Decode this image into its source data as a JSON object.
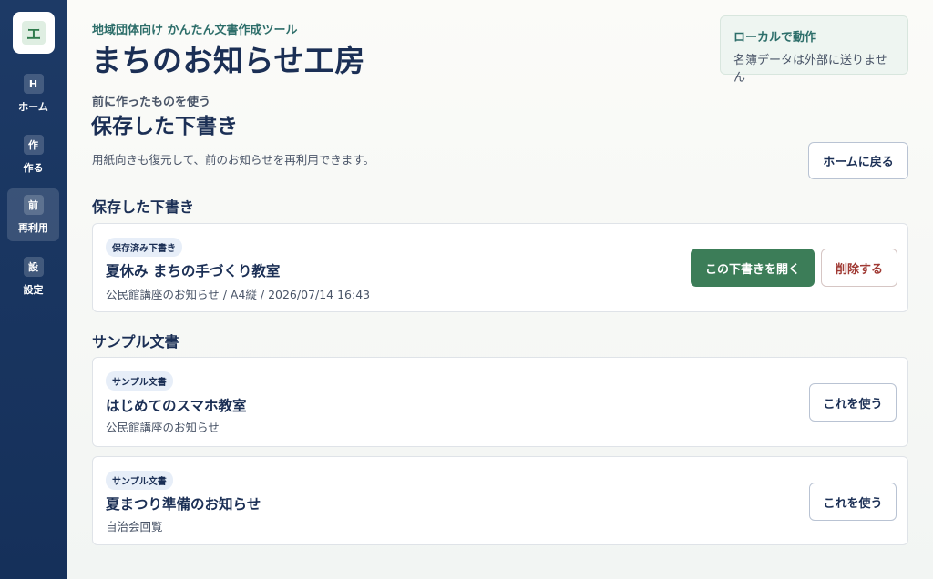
{
  "sidebar": {
    "logo_glyph": "エ",
    "items": [
      {
        "chip": "H",
        "label": "ホーム"
      },
      {
        "chip": "作",
        "label": "作る"
      },
      {
        "chip": "前",
        "label": "再利用"
      },
      {
        "chip": "設",
        "label": "設定"
      }
    ]
  },
  "header": {
    "eyebrow": "地域団体向け かんたん文書作成ツール",
    "title": "まちのお知らせ工房",
    "local_title": "ローカルで動作",
    "local_desc": "名簿データは外部に送りません"
  },
  "page": {
    "eyebrow": "前に作ったものを使う",
    "title": "保存した下書き",
    "description": "用紙向きも復元して、前のお知らせを再利用できます。",
    "home_button": "ホームに戻る"
  },
  "drafts": {
    "section_title": "保存した下書き",
    "items": [
      {
        "badge": "保存済み下書き",
        "title": "夏休み まちの手づくり教室",
        "meta": "公民館講座のお知らせ / A4縦 / 2026/07/14 16:43",
        "open_label": "この下書きを開く",
        "delete_label": "削除する"
      }
    ]
  },
  "samples": {
    "section_title": "サンプル文書",
    "items": [
      {
        "badge": "サンプル文書",
        "title": "はじめてのスマホ教室",
        "meta": "公民館講座のお知らせ",
        "use_label": "これを使う"
      },
      {
        "badge": "サンプル文書",
        "title": "夏まつり準備のお知らせ",
        "meta": "自治会回覧",
        "use_label": "これを使う"
      }
    ]
  },
  "colors": {
    "sidebar": "#1d3a66",
    "accent_green": "#3c7d58",
    "danger": "#a03a34",
    "heading": "#1b2f55"
  }
}
